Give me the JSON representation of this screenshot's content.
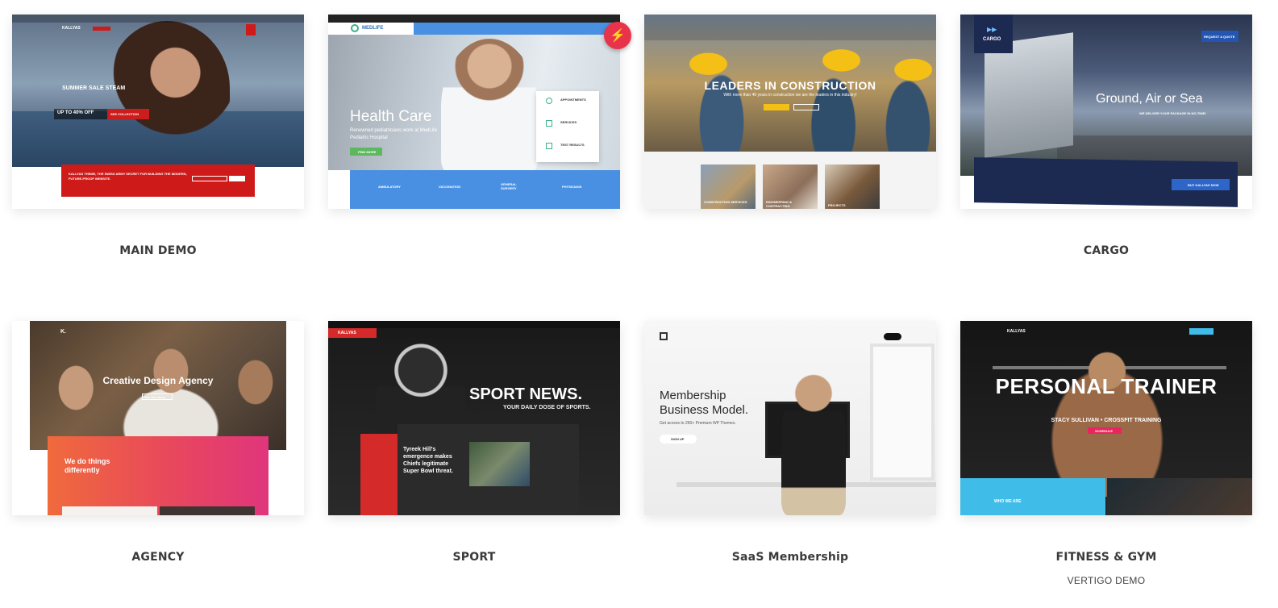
{
  "demos": [
    {
      "label": "MAIN DEMO",
      "hero": {
        "brand": "KALLYAS",
        "headline": "SUMMER SALE STEAM",
        "offer": "UP TO 40% OFF",
        "offer_button": "SEE COLLECTION",
        "banner": "KALLYAS THEME, THE SWISS ARMY SECRET FOR BUILDING THE MODERN, FUTURE-PROOF WEBSITE.",
        "banner_button": "JOIN OUR NEWSLETTER",
        "banner_button_2": "BUY NOW"
      }
    },
    {
      "label": "",
      "hero": {
        "brand": "MEDLIFE",
        "headline": "Health Care",
        "subline": "Renowned pediatricians work at MedLife Pediatric Hospital",
        "button": "FIND MORE",
        "panel_items": [
          "APPOINTMENTS",
          "SERVICES",
          "TEST RESULTS"
        ],
        "services": [
          "AMBULATORY",
          "VACCINATION",
          "GENERAL SURGERY",
          "PHYSICIANS"
        ]
      }
    },
    {
      "label": "",
      "hero": {
        "headline": "LEADERS IN CONSTRUCTION",
        "subline": "With more than 40 years in construction we are the leaders in this industry!",
        "thumbs": [
          "CONSTRUCTION SERVICES",
          "ENGINEERING & CONTRACTING",
          "PROJECTS"
        ]
      }
    },
    {
      "label": "CARGO",
      "hero": {
        "brand": "CARGO",
        "headline": "Ground, Air or Sea",
        "subline": "WE DELIVER YOUR PACKAGE IN NO-TIME!",
        "button": "REQUEST A QUOTE",
        "panel_button": "BUY KALLYAS NOW"
      }
    },
    {
      "label": "AGENCY",
      "hero": {
        "brand": "K.",
        "headline": "Creative Design Agency",
        "button": "See Our Work",
        "subheadline": "We do things differently"
      }
    },
    {
      "label": "SPORT",
      "hero": {
        "brand": "KALLYAS",
        "headline": "SPORT NEWS.",
        "subline": "YOUR DAILY DOSE OF SPORTS.",
        "story": "Tyreek Hill's emergence makes Chiefs legitimate Super Bowl threat."
      }
    },
    {
      "label": "SaaS Membership",
      "hero": {
        "headline": "Membership Business Model.",
        "subline": "Get access to 250+ Premium WP Themes.",
        "button": "SIGN UP"
      }
    },
    {
      "label": "FITNESS & GYM",
      "sublabel": "VERTIGO DEMO",
      "hero": {
        "brand": "KALLYAS",
        "headline": "PERSONAL TRAINER",
        "subline": "STACY SULLIVAN • CROSSFIT TRAINING",
        "button": "SCHEDULE",
        "section": "WHO WE ARE"
      }
    }
  ],
  "badge": {
    "icon": "lightning-icon",
    "glyph": "⚡"
  }
}
